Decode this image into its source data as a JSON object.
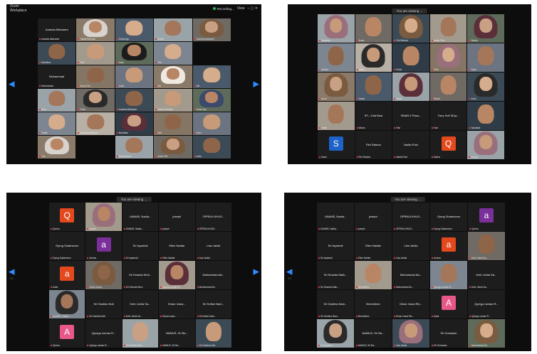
{
  "meeting": {
    "app_line1": "Zoom",
    "app_line2": "Workplace",
    "recording": "Recording...",
    "view": "View"
  },
  "speaker_tags": {
    "tr": "You are viewing ...",
    "bl": "You are viewing ...",
    "br": "You are viewing ..."
  },
  "page_labels": {
    "bl": "2/2",
    "br": "2/2"
  },
  "names": {
    "tl": [
      "Ananda Maharani",
      "Haikal Rahman",
      "Dinda Ayu",
      "Fadhil",
      "Ananda Maharani",
      "Mukhlisin",
      "Rafi",
      "Intan",
      "Tria",
      "Muhammad",
      "Anisa Fitri",
      "Aulia",
      "Nur",
      "Alif",
      "Rina",
      "Dhea"
    ],
    "tr": [
      "Salsabila",
      "Ihsan",
      "Fitri Rahma",
      "Nadia Putri",
      "Salma",
      "Annisa",
      "Ratna",
      "Rizka",
      "Putri",
      "Syifa",
      "Nurul",
      "Dinda",
      "Siska",
      "Rahmi",
      "Aulia",
      "Indah",
      "Wulan",
      "Fikri",
      "Fani"
    ],
    "tr_center": [
      "IPI – Kita Bisa",
      "SMAN 5 Pasa...",
      "Fany Sofi 35 ja..."
    ],
    "bl_center": [
      "UNAMS, Nadia...",
      "joseph",
      "OPRIKA KHUS...",
      "Gyrog Sudarwono",
      "Sri Isyamuti",
      "Elien Nadiar",
      "Lisa Janila",
      "Sri Kinanta Wuli...",
      "Muhammad Alv...",
      "Sri Gantina Nuti",
      "Kele Julnia Sa...",
      "Dinan Ivana...",
      "Sri Sofian Nam...",
      "Qyrego usman R...",
      "NAMUS, Sri Ba..."
    ],
    "br_center": [
      "UNAMS, Nadia...",
      "joseph",
      "OPRIKA KHUS...",
      "Gyrog Sudarwono",
      "Sri Isyamuti",
      "Elien Nadiar",
      "Lisa Janila",
      "Sri Kinanta Nath...",
      "Muhammad Alv...",
      "Kele Julnia Sa...",
      "Sri Gantina Nam...",
      "Brenedbev",
      "Dinan Ivana Riz...",
      "Qyrego usman R...",
      "NAMUS, Sri Ba...",
      "Sri Gunawan"
    ],
    "letter_names": [
      "Qorina",
      "Annisa",
      "Aulia",
      "Qorina"
    ]
  },
  "letters": {
    "tr_s": "S",
    "tr_q": "Q",
    "bl_q": "Q",
    "bl_a1": "a",
    "bl_a2": "a",
    "bl_a3": "A",
    "br_a1": "a",
    "br_a2": "a",
    "br_a3": "A"
  },
  "colors": {
    "letter_orange": "#e3491d",
    "letter_purple": "#7a2f9a",
    "letter_pink": "#e8578a",
    "letter_blue": "#1d62c9",
    "zoom_blue": "#2d8cff"
  }
}
